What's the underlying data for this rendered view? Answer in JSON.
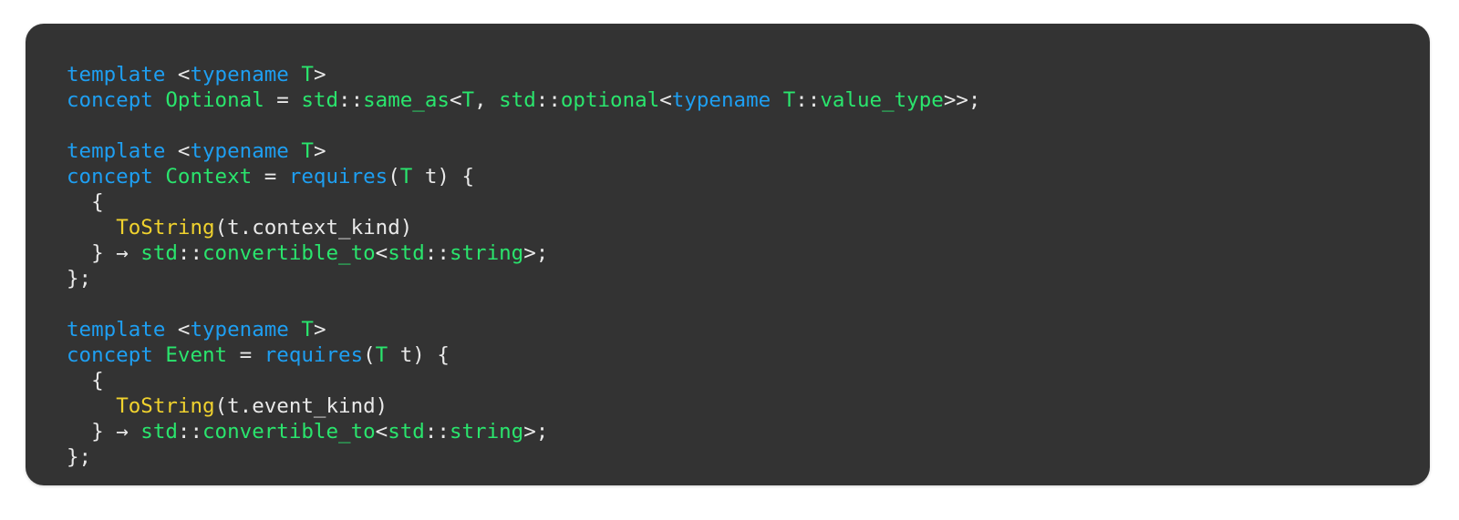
{
  "card": {
    "background_color": "#333333",
    "corner_radius_px": 20,
    "language": "cpp"
  },
  "theme": {
    "page_background": "#ffffff",
    "keyword_color": "#1e9ff2",
    "type_color": "#2ae56d",
    "function_color": "#f0d22e",
    "punctuation_color": "#e9e9e9"
  },
  "code": {
    "plain_text": "template <typename T>\nconcept Optional = std::same_as<T, std::optional<typename T::value_type>>;\n\ntemplate <typename T>\nconcept Context = requires(T t) {\n  {\n    ToString(t.context_kind)\n  } → std::convertible_to<std::string>;\n};\n\ntemplate <typename T>\nconcept Event = requires(T t) {\n  {\n    ToString(t.event_kind)\n  } → std::convertible_to<std::string>;\n};",
    "lines": [
      {
        "id": "l1",
        "tokens": [
          {
            "t": "template",
            "c": "kw"
          },
          {
            "t": " ",
            "c": "pun"
          },
          {
            "t": "<",
            "c": "pun"
          },
          {
            "t": "typename",
            "c": "kw"
          },
          {
            "t": " ",
            "c": "pun"
          },
          {
            "t": "T",
            "c": "typ"
          },
          {
            "t": ">",
            "c": "pun"
          }
        ]
      },
      {
        "id": "l2",
        "tokens": [
          {
            "t": "concept",
            "c": "kw"
          },
          {
            "t": " ",
            "c": "pun"
          },
          {
            "t": "Optional",
            "c": "typ"
          },
          {
            "t": " = ",
            "c": "pun"
          },
          {
            "t": "std",
            "c": "typ"
          },
          {
            "t": "::",
            "c": "pun"
          },
          {
            "t": "same_as",
            "c": "typ"
          },
          {
            "t": "<",
            "c": "pun"
          },
          {
            "t": "T",
            "c": "typ"
          },
          {
            "t": ", ",
            "c": "pun"
          },
          {
            "t": "std",
            "c": "typ"
          },
          {
            "t": "::",
            "c": "pun"
          },
          {
            "t": "optional",
            "c": "typ"
          },
          {
            "t": "<",
            "c": "pun"
          },
          {
            "t": "typename",
            "c": "kw"
          },
          {
            "t": " ",
            "c": "pun"
          },
          {
            "t": "T",
            "c": "typ"
          },
          {
            "t": "::",
            "c": "pun"
          },
          {
            "t": "value_type",
            "c": "typ"
          },
          {
            "t": ">>;",
            "c": "pun"
          }
        ]
      },
      {
        "id": "l3",
        "tokens": [
          {
            "t": " ",
            "c": "pun"
          }
        ]
      },
      {
        "id": "l4",
        "tokens": [
          {
            "t": "template",
            "c": "kw"
          },
          {
            "t": " ",
            "c": "pun"
          },
          {
            "t": "<",
            "c": "pun"
          },
          {
            "t": "typename",
            "c": "kw"
          },
          {
            "t": " ",
            "c": "pun"
          },
          {
            "t": "T",
            "c": "typ"
          },
          {
            "t": ">",
            "c": "pun"
          }
        ]
      },
      {
        "id": "l5",
        "tokens": [
          {
            "t": "concept",
            "c": "kw"
          },
          {
            "t": " ",
            "c": "pun"
          },
          {
            "t": "Context",
            "c": "typ"
          },
          {
            "t": " = ",
            "c": "pun"
          },
          {
            "t": "requires",
            "c": "kw"
          },
          {
            "t": "(",
            "c": "pun"
          },
          {
            "t": "T",
            "c": "typ"
          },
          {
            "t": " t) {",
            "c": "pun"
          }
        ]
      },
      {
        "id": "l6",
        "tokens": [
          {
            "t": "  {",
            "c": "pun"
          }
        ]
      },
      {
        "id": "l7",
        "tokens": [
          {
            "t": "    ",
            "c": "pun"
          },
          {
            "t": "ToString",
            "c": "fn"
          },
          {
            "t": "(t.context_kind)",
            "c": "pun"
          }
        ]
      },
      {
        "id": "l8",
        "tokens": [
          {
            "t": "  } → ",
            "c": "pun"
          },
          {
            "t": "std",
            "c": "typ"
          },
          {
            "t": "::",
            "c": "pun"
          },
          {
            "t": "convertible_to",
            "c": "typ"
          },
          {
            "t": "<",
            "c": "pun"
          },
          {
            "t": "std",
            "c": "typ"
          },
          {
            "t": "::",
            "c": "pun"
          },
          {
            "t": "string",
            "c": "typ"
          },
          {
            "t": ">;",
            "c": "pun"
          }
        ]
      },
      {
        "id": "l9",
        "tokens": [
          {
            "t": "};",
            "c": "pun"
          }
        ]
      },
      {
        "id": "l10",
        "tokens": [
          {
            "t": " ",
            "c": "pun"
          }
        ]
      },
      {
        "id": "l11",
        "tokens": [
          {
            "t": "template",
            "c": "kw"
          },
          {
            "t": " ",
            "c": "pun"
          },
          {
            "t": "<",
            "c": "pun"
          },
          {
            "t": "typename",
            "c": "kw"
          },
          {
            "t": " ",
            "c": "pun"
          },
          {
            "t": "T",
            "c": "typ"
          },
          {
            "t": ">",
            "c": "pun"
          }
        ]
      },
      {
        "id": "l12",
        "tokens": [
          {
            "t": "concept",
            "c": "kw"
          },
          {
            "t": " ",
            "c": "pun"
          },
          {
            "t": "Event",
            "c": "typ"
          },
          {
            "t": " = ",
            "c": "pun"
          },
          {
            "t": "requires",
            "c": "kw"
          },
          {
            "t": "(",
            "c": "pun"
          },
          {
            "t": "T",
            "c": "typ"
          },
          {
            "t": " t) {",
            "c": "pun"
          }
        ]
      },
      {
        "id": "l13",
        "tokens": [
          {
            "t": "  {",
            "c": "pun"
          }
        ]
      },
      {
        "id": "l14",
        "tokens": [
          {
            "t": "    ",
            "c": "pun"
          },
          {
            "t": "ToString",
            "c": "fn"
          },
          {
            "t": "(t.event_kind)",
            "c": "pun"
          }
        ]
      },
      {
        "id": "l15",
        "tokens": [
          {
            "t": "  } → ",
            "c": "pun"
          },
          {
            "t": "std",
            "c": "typ"
          },
          {
            "t": "::",
            "c": "pun"
          },
          {
            "t": "convertible_to",
            "c": "typ"
          },
          {
            "t": "<",
            "c": "pun"
          },
          {
            "t": "std",
            "c": "typ"
          },
          {
            "t": "::",
            "c": "pun"
          },
          {
            "t": "string",
            "c": "typ"
          },
          {
            "t": ">;",
            "c": "pun"
          }
        ]
      },
      {
        "id": "l16",
        "tokens": [
          {
            "t": "};",
            "c": "pun"
          }
        ]
      }
    ]
  }
}
